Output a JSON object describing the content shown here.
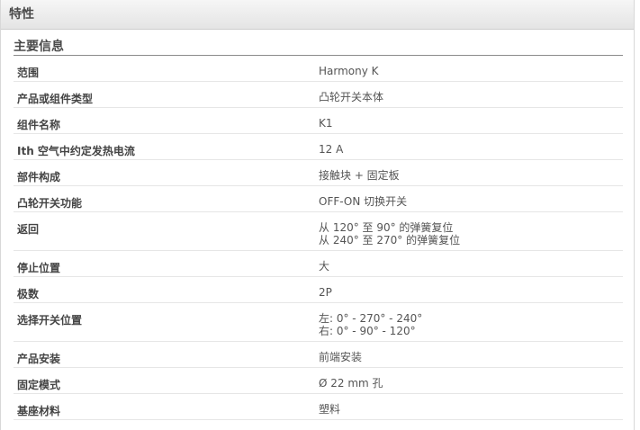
{
  "header": {
    "title": "特性"
  },
  "section": {
    "title": "主要信息"
  },
  "rows": [
    {
      "label": "范围",
      "lines": [
        "Harmony K"
      ]
    },
    {
      "label": "产品或组件类型",
      "lines": [
        "凸轮开关本体"
      ]
    },
    {
      "label": "组件名称",
      "lines": [
        "K1"
      ]
    },
    {
      "label": "Ith 空气中约定发热电流",
      "lines": [
        "12 A"
      ]
    },
    {
      "label": "部件构成",
      "lines": [
        "接触块 + 固定板"
      ]
    },
    {
      "label": "凸轮开关功能",
      "lines": [
        "OFF-ON 切换开关"
      ]
    },
    {
      "label": "返回",
      "lines": [
        "从 120° 至 90° 的弹簧复位",
        "从 240° 至 270° 的弹簧复位"
      ]
    },
    {
      "label": "停止位置",
      "lines": [
        "大"
      ]
    },
    {
      "label": "极数",
      "lines": [
        "2P"
      ]
    },
    {
      "label": "选择开关位置",
      "lines": [
        "左: 0° - 270° - 240°",
        "右: 0° - 90° - 120°"
      ]
    },
    {
      "label": "产品安装",
      "lines": [
        "前端安装"
      ]
    },
    {
      "label": "固定模式",
      "lines": [
        "Ø 22 mm 孔"
      ]
    },
    {
      "label": "基座材料",
      "lines": [
        "塑料"
      ]
    }
  ]
}
